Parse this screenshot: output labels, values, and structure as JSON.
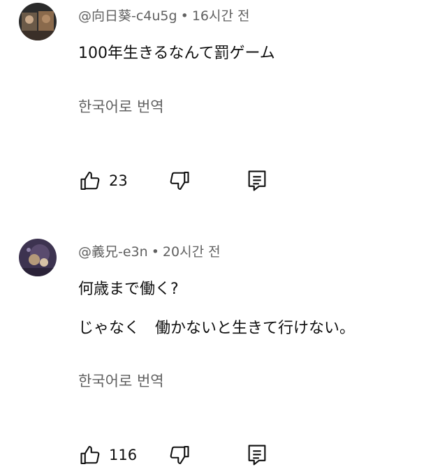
{
  "comments": [
    {
      "author": "@向日葵-c4u5g",
      "separator": "•",
      "time": "16시간 전",
      "lines": [
        "100年生きるなんて罰ゲーム"
      ],
      "translate_label": "한국어로 번역",
      "likes": "23",
      "avatar_colors": [
        "#4a3a2e",
        "#8a6a4c"
      ]
    },
    {
      "author": "@義兄-e3n",
      "separator": "•",
      "time": "20시간 전",
      "lines": [
        "何歳まで働く?",
        "じゃなく　働かないと生きて行けない。"
      ],
      "translate_label": "한국어로 번역",
      "likes": "116",
      "avatar_colors": [
        "#4b3e5e",
        "#b59a7a"
      ]
    }
  ],
  "icons": {
    "like": "thumbs-up-icon",
    "dislike": "thumbs-down-icon",
    "reply": "reply-icon"
  },
  "colors": {
    "primary_text": "#0f0f0f",
    "secondary_text": "#606060",
    "background": "#ffffff"
  }
}
